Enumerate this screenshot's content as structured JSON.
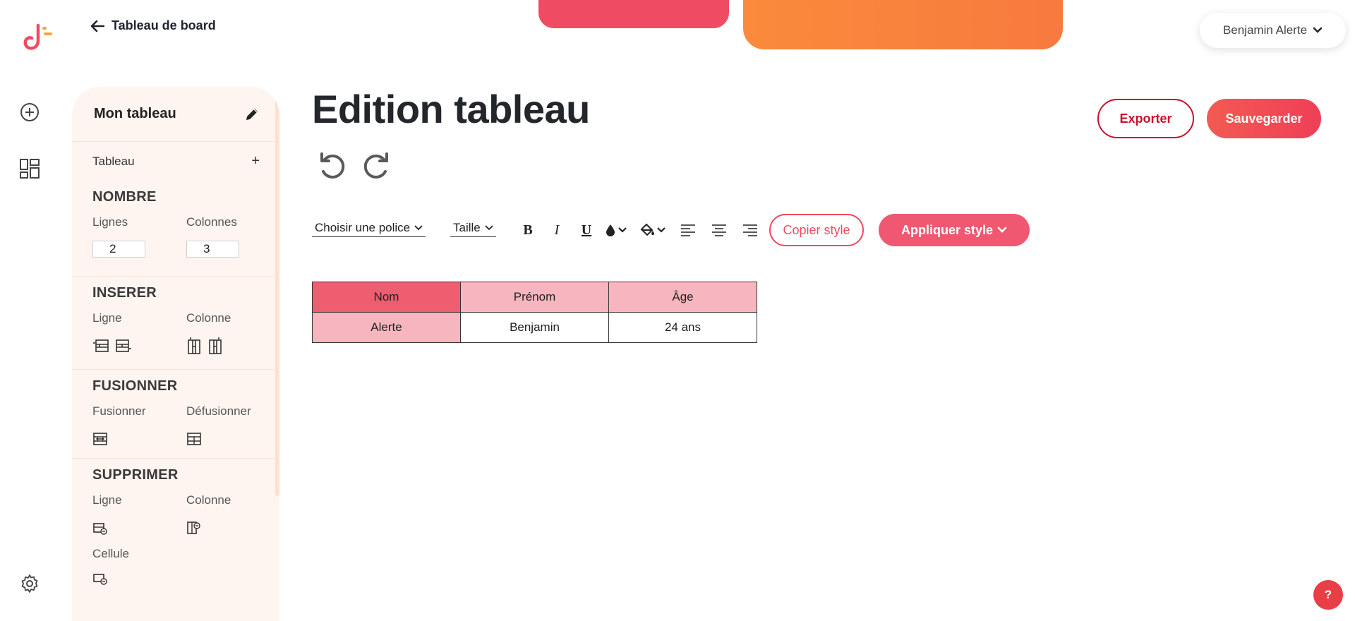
{
  "nav": {
    "back_label": "Tableau de board",
    "user_name": "Benjamin Alerte"
  },
  "panel": {
    "title": "Mon tableau",
    "table_row_label": "Tableau",
    "table_row_add": "+",
    "nombre": {
      "title": "NOMBRE",
      "rows_label": "Lignes",
      "cols_label": "Colonnes",
      "rows_value": "2",
      "cols_value": "3"
    },
    "inserer": {
      "title": "INSERER",
      "row_label": "Ligne",
      "col_label": "Colonne"
    },
    "fusionner": {
      "title": "FUSIONNER",
      "merge_label": "Fusionner",
      "unmerge_label": "Défusionner"
    },
    "supprimer": {
      "title": "SUPPRIMER",
      "row_label": "Ligne",
      "col_label": "Colonne",
      "cell_label": "Cellule"
    }
  },
  "main": {
    "title": "Edition tableau",
    "export_label": "Exporter",
    "save_label": "Sauvegarder"
  },
  "toolbar": {
    "font_select": "Choisir une police",
    "size_select": "Taille",
    "bold": "B",
    "italic": "I",
    "underline": "U",
    "copy_style": "Copier style",
    "apply_style": "Appliquer style"
  },
  "table": {
    "headers": [
      "Nom",
      "Prénom",
      "Âge"
    ],
    "rows": [
      [
        "Alerte",
        "Benjamin",
        "24 ans"
      ]
    ]
  },
  "help_label": "?",
  "colors": {
    "accent_red": "#ef4b62",
    "accent_orange": "#fb8a3c",
    "header_cell": "#ef5d70",
    "light_cell": "#f7b6bf",
    "panel_bg": "#fff5f0"
  }
}
